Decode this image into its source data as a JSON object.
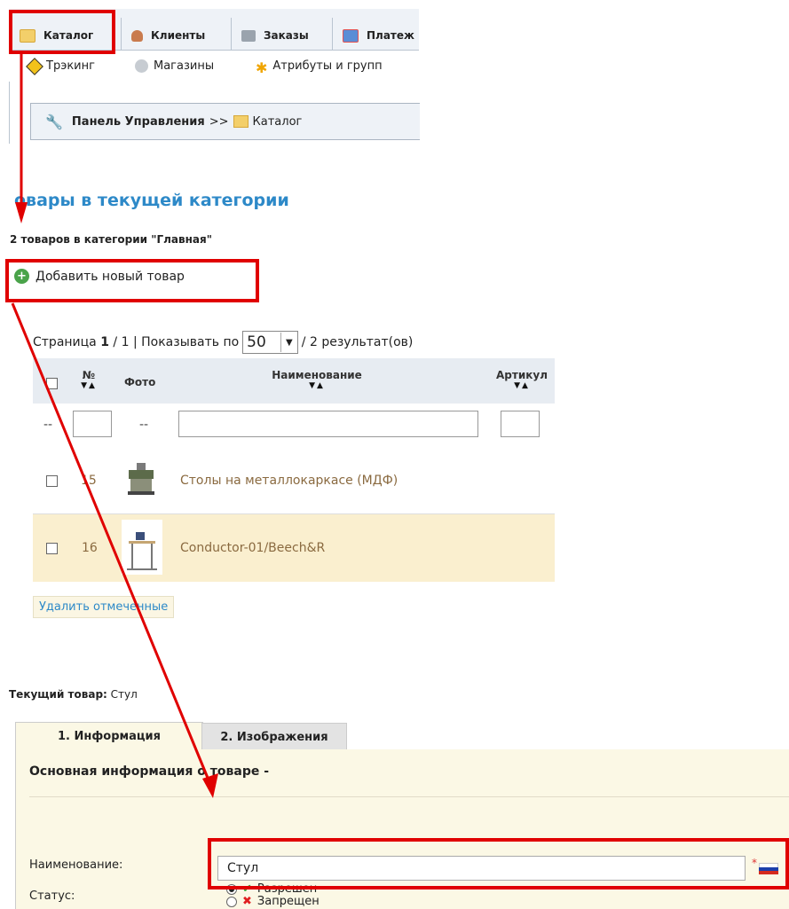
{
  "top_tabs": [
    {
      "label": "Каталог",
      "icon": "folder-icon",
      "color": "#f3cf6a"
    },
    {
      "label": "Клиенты",
      "icon": "user-icon",
      "color": "#c97b4e"
    },
    {
      "label": "Заказы",
      "icon": "cart-icon",
      "color": "#9aa3ad"
    },
    {
      "label": "Платеж",
      "icon": "payment-icon",
      "color": "#5a8dd6"
    }
  ],
  "sub_nav": [
    {
      "label": "Трэкинг",
      "icon": "warning-icon"
    },
    {
      "label": "Магазины",
      "icon": "gear-icon"
    },
    {
      "label": "Атрибуты и групп",
      "icon": "star-icon"
    }
  ],
  "breadcrumb": {
    "home": "Панель Управления",
    "sep": ">>",
    "current": "Каталог"
  },
  "section_title": "овары в текущей категории",
  "count_text": "2 товаров в категории \"Главная\"",
  "add_product": "Добавить новый товар",
  "pager": {
    "page_label": "Страница",
    "page": "1",
    "total": "/ 1",
    "sep": "|",
    "show_label": "Показывать по",
    "per_page": "50",
    "results": "/ 2 результат(ов)"
  },
  "table": {
    "headers": {
      "num": "№",
      "photo": "Фото",
      "name": "Наименование",
      "sku": "Артикул"
    },
    "filter_dash": "--",
    "rows": [
      {
        "num": "15",
        "name": "Столы на металлокаркасе (МДФ)"
      },
      {
        "num": "16",
        "name": "Conductor-01/Beech&R"
      }
    ]
  },
  "delete_selected": "Удалить отмеченные",
  "current_product": {
    "label": "Текущий товар:",
    "value": "Стул"
  },
  "tabs": [
    {
      "label": "1. Информация"
    },
    {
      "label": "2. Изображения"
    }
  ],
  "section_header": "Основная информация о товаре -",
  "form": {
    "name_label": "Наименование:",
    "name_value": "Стул",
    "required_mark": "*",
    "status_label": "Статус:",
    "status_on": "Разрешен",
    "status_off": "Запрещен"
  },
  "colors": {
    "accent": "#2d89c8",
    "highlight": "#e00000",
    "row_highlight": "#faefcf",
    "link": "#8a6a40"
  }
}
